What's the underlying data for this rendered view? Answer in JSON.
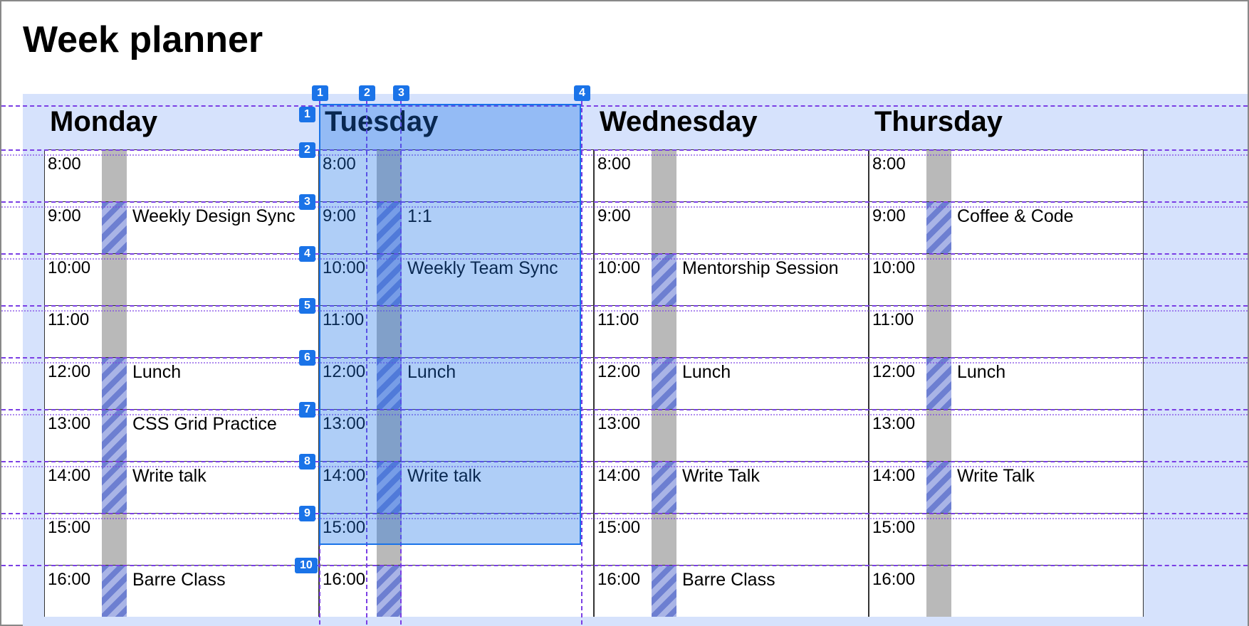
{
  "title": "Week planner",
  "days": [
    "Monday",
    "Tuesday",
    "Wednesday",
    "Thursday"
  ],
  "hours": [
    "8:00",
    "9:00",
    "10:00",
    "11:00",
    "12:00",
    "13:00",
    "14:00",
    "15:00",
    "16:00"
  ],
  "overlay": {
    "col_badges": [
      "1",
      "2",
      "3",
      "4"
    ],
    "row_badges": [
      "1",
      "2",
      "3",
      "4",
      "5",
      "6",
      "7",
      "8",
      "9",
      "10"
    ]
  },
  "events": {
    "mon": [
      {
        "t": "8:00",
        "e": "",
        "b": false
      },
      {
        "t": "9:00",
        "e": "Weekly Design Sync",
        "b": true
      },
      {
        "t": "10:00",
        "e": "",
        "b": false
      },
      {
        "t": "11:00",
        "e": "",
        "b": false
      },
      {
        "t": "12:00",
        "e": "Lunch",
        "b": true
      },
      {
        "t": "13:00",
        "e": "CSS Grid Practice",
        "b": true
      },
      {
        "t": "14:00",
        "e": "Write talk",
        "b": true
      },
      {
        "t": "15:00",
        "e": "",
        "b": false
      },
      {
        "t": "16:00",
        "e": "Barre Class",
        "b": true
      }
    ],
    "tue": [
      {
        "t": "8:00",
        "e": "",
        "b": false
      },
      {
        "t": "9:00",
        "e": "1:1",
        "b": true
      },
      {
        "t": "10:00",
        "e": "Weekly Team Sync",
        "b": true
      },
      {
        "t": "11:00",
        "e": "",
        "b": false
      },
      {
        "t": "12:00",
        "e": "Lunch",
        "b": true
      },
      {
        "t": "13:00",
        "e": "",
        "b": false
      },
      {
        "t": "14:00",
        "e": "Write talk",
        "b": true
      },
      {
        "t": "15:00",
        "e": "",
        "b": false
      },
      {
        "t": "16:00",
        "e": "",
        "b": true
      }
    ],
    "wed": [
      {
        "t": "8:00",
        "e": "",
        "b": false
      },
      {
        "t": "9:00",
        "e": "",
        "b": false
      },
      {
        "t": "10:00",
        "e": "Mentorship Session",
        "b": true
      },
      {
        "t": "11:00",
        "e": "",
        "b": false
      },
      {
        "t": "12:00",
        "e": "Lunch",
        "b": true
      },
      {
        "t": "13:00",
        "e": "",
        "b": false
      },
      {
        "t": "14:00",
        "e": "Write Talk",
        "b": true
      },
      {
        "t": "15:00",
        "e": "",
        "b": false
      },
      {
        "t": "16:00",
        "e": "Barre Class",
        "b": true
      }
    ],
    "thu": [
      {
        "t": "8:00",
        "e": "",
        "b": false
      },
      {
        "t": "9:00",
        "e": "Coffee & Code",
        "b": true
      },
      {
        "t": "10:00",
        "e": "",
        "b": false
      },
      {
        "t": "11:00",
        "e": "",
        "b": false
      },
      {
        "t": "12:00",
        "e": "Lunch",
        "b": true
      },
      {
        "t": "13:00",
        "e": "",
        "b": false
      },
      {
        "t": "14:00",
        "e": "Write Talk",
        "b": true
      },
      {
        "t": "15:00",
        "e": "",
        "b": false
      },
      {
        "t": "16:00",
        "e": "",
        "b": false
      }
    ]
  }
}
